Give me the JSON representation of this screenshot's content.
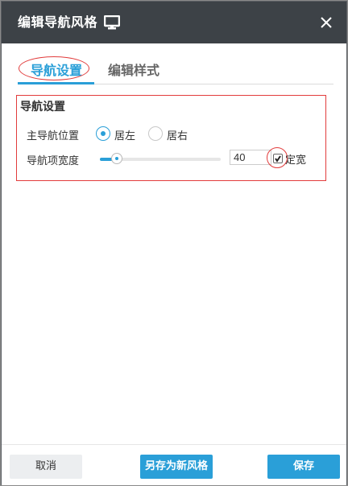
{
  "dialog": {
    "title": "编辑导航风格",
    "title_icon": "monitor-icon",
    "close_icon": "close-icon"
  },
  "tabs": [
    {
      "label": "导航设置",
      "active": true
    },
    {
      "label": "编辑样式",
      "active": false
    }
  ],
  "nav_settings": {
    "section_title": "导航设置",
    "position": {
      "label": "主导航位置",
      "options": [
        {
          "label": "居左",
          "checked": true
        },
        {
          "label": "居右",
          "checked": false
        }
      ]
    },
    "width": {
      "label": "导航项宽度",
      "value": "40",
      "slider_fraction": 0.14,
      "fixed_width_label": "定宽",
      "fixed_width_checked": true
    }
  },
  "footer": {
    "cancel_label": "取消",
    "save_as_label": "另存为新风格",
    "save_label": "保存"
  },
  "colors": {
    "accent": "#2a9fd8",
    "titlebar": "#3d4247",
    "annotation": "#e23c3c"
  }
}
